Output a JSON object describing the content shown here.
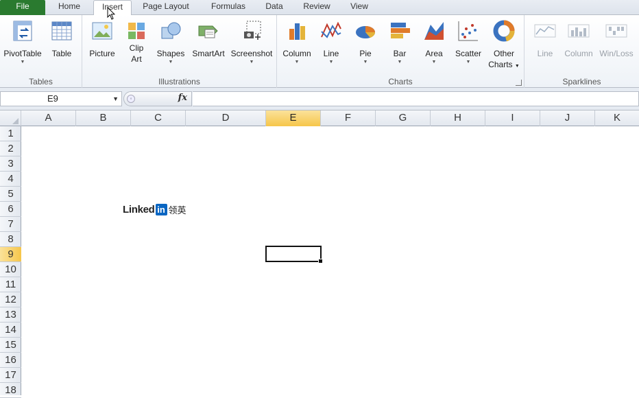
{
  "tabs": [
    "File",
    "Home",
    "Insert",
    "Page Layout",
    "Formulas",
    "Data",
    "Review",
    "View"
  ],
  "active_tab": "Insert",
  "ribbon": {
    "tables": {
      "label": "Tables",
      "pivot": "PivotTable",
      "table": "Table"
    },
    "illustrations": {
      "label": "Illustrations",
      "picture": "Picture",
      "clipart1": "Clip",
      "clipart2": "Art",
      "shapes": "Shapes",
      "smartart": "SmartArt",
      "screenshot": "Screenshot"
    },
    "charts": {
      "label": "Charts",
      "column": "Column",
      "line": "Line",
      "pie": "Pie",
      "bar": "Bar",
      "area": "Area",
      "scatter": "Scatter",
      "other1": "Other",
      "other2": "Charts"
    },
    "sparklines": {
      "label": "Sparklines",
      "line": "Line",
      "column": "Column",
      "winloss": "Win/Loss"
    }
  },
  "formula_bar": {
    "name_box": "E9",
    "fx": "fx",
    "formula": ""
  },
  "columns": [
    "A",
    "B",
    "C",
    "D",
    "E",
    "F",
    "G",
    "H",
    "I",
    "J",
    "K"
  ],
  "selected_column": "E",
  "rows": [
    "1",
    "2",
    "3",
    "4",
    "5",
    "6",
    "7",
    "8",
    "9",
    "10",
    "11",
    "12",
    "13",
    "14",
    "15",
    "16",
    "17",
    "18"
  ],
  "selected_row": "9",
  "logo": {
    "word": "Linked",
    "in": "in",
    "cn": "领英"
  }
}
